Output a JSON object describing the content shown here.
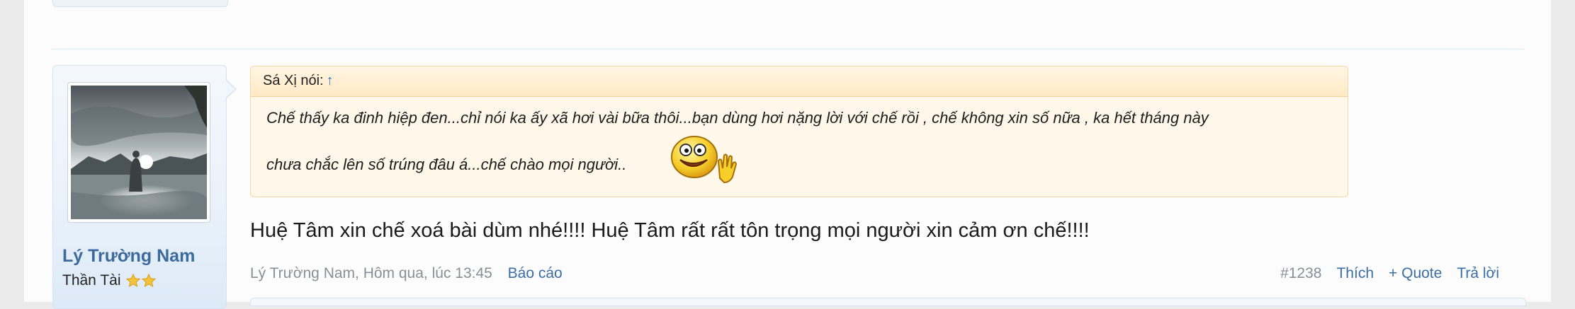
{
  "post": {
    "user": {
      "name": "Lý Trường Nam",
      "title": "Thần Tài",
      "stars": 2,
      "avatar_icon": "landscape-silhouette-photo"
    },
    "quote": {
      "author_line": "Sá Xị nói:",
      "jump_arrow": "↑",
      "line1": "Chế thấy ka đinh hiệp đen...chỉ nói ka ấy xã hơi vài bữa thôi...bạn dùng hơi nặng lời với chế rồi , chế không xin số nữa , ka hết tháng này",
      "line2": "chưa chắc lên số trúng đâu á...chế chào mọi người..",
      "smiley_icon": "waving-smiley-icon"
    },
    "message": "Huệ Tâm xin chế xoá bài dùm nhé!!!! Huệ Tâm rất rất tôn trọng mọi người xin cảm ơn chế!!!!",
    "footer": {
      "meta": "Lý Trường Nam, Hôm qua, lúc 13:45",
      "report": "Báo cáo",
      "post_number": "#1238",
      "like": "Thích",
      "quote": "+ Quote",
      "reply": "Trả lời"
    }
  },
  "colors": {
    "link": "#3a6ea6",
    "username": "#3d6a9c",
    "quote_bg": "#fff7e9",
    "quote_border": "#f3d9a8"
  }
}
